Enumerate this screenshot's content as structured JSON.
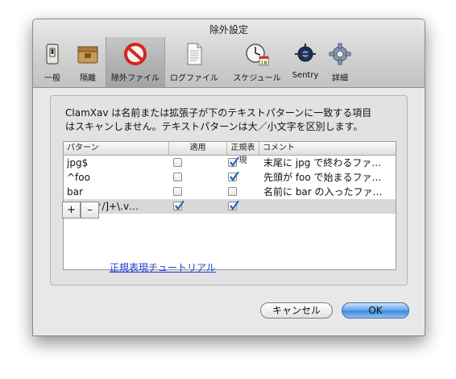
{
  "window": {
    "title": "除外設定"
  },
  "toolbar": {
    "items": [
      {
        "label": "一般",
        "icon": "switch-icon"
      },
      {
        "label": "隔離",
        "icon": "box-icon"
      },
      {
        "label": "除外ファイル",
        "icon": "prohibited-icon",
        "selected": true
      },
      {
        "label": "ログファイル",
        "icon": "document-icon"
      },
      {
        "label": "スケジュール",
        "icon": "clock-calendar-icon"
      },
      {
        "label": "Sentry",
        "icon": "satellite-icon"
      },
      {
        "label": "詳細",
        "icon": "gear-icon"
      }
    ]
  },
  "description": {
    "line1": "ClamXav は名前または拡張子が下のテキストパターンに一致する項目",
    "line2": "はスキャンしません。テキストパターンは大／小文字を区別します。"
  },
  "table": {
    "headers": {
      "pattern": "パターン",
      "apply": "適用",
      "regex": "正規表現",
      "comment": "コメント"
    },
    "rows": [
      {
        "pattern": "jpg$",
        "apply": false,
        "regex": true,
        "comment": "末尾に jpg で終わるファ…"
      },
      {
        "pattern": "^foo",
        "apply": false,
        "regex": true,
        "comment": "先頭が foo で始まるファ…"
      },
      {
        "pattern": "bar",
        "apply": false,
        "regex": false,
        "comment": "名前に bar の入ったファ…"
      },
      {
        "pattern": "^(.*/[^/]+\\.v…",
        "apply": true,
        "regex": true,
        "comment": "",
        "selected": true
      }
    ]
  },
  "controls": {
    "add_label": "+",
    "remove_label": "–",
    "tutorial_link": "正規表現チュートリアル"
  },
  "buttons": {
    "cancel": "キャンセル",
    "ok": "OK"
  },
  "colors": {
    "accent": "#3b86dc",
    "link": "#1f3fd6",
    "check": "#1f5fb8"
  }
}
